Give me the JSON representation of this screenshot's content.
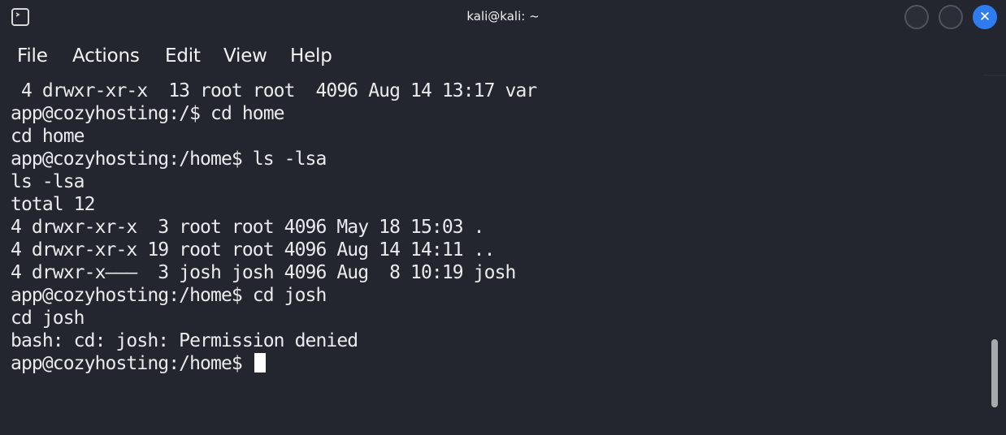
{
  "window": {
    "title": "kali@kali: ~",
    "icon": "terminal-icon",
    "controls": [
      "minimize-icon",
      "maximize-icon",
      "close-icon"
    ],
    "close_glyph": "✕",
    "colors": {
      "background": "#23262e",
      "close_accent": "#2f7cf0",
      "text": "#e9ebee"
    }
  },
  "menu": {
    "items": [
      {
        "label": "File"
      },
      {
        "label": "Actions"
      },
      {
        "label": "Edit"
      },
      {
        "label": "View"
      },
      {
        "label": "Help"
      }
    ]
  },
  "terminal": {
    "lines": [
      " 4 drwxr-xr-x  13 root root  4096 Aug 14 13:17 var",
      "app@cozyhosting:/$ cd home",
      "cd home",
      "app@cozyhosting:/home$ ls -lsa",
      "ls -lsa",
      "total 12",
      "4 drwxr-xr-x  3 root root 4096 May 18 15:03 .",
      "4 drwxr-xr-x 19 root root 4096 Aug 14 14:11 ..",
      "4 drwxr-x———  3 josh josh 4096 Aug  8 10:19 josh",
      "app@cozyhosting:/home$ cd josh",
      "cd josh",
      "bash: cd: josh: Permission denied"
    ],
    "prompt": "app@cozyhosting:/home$ "
  }
}
